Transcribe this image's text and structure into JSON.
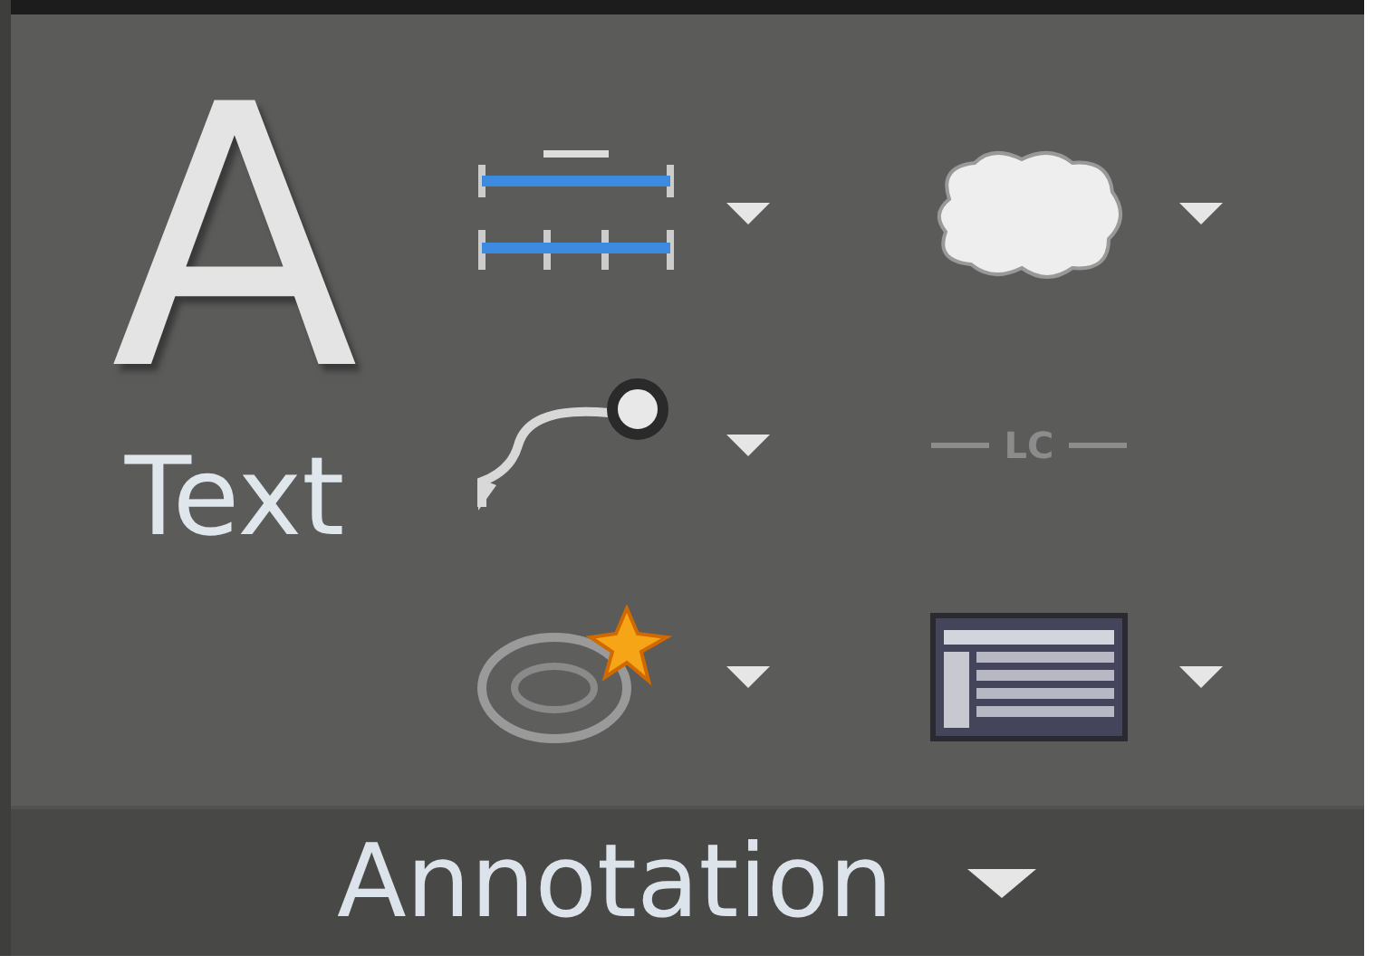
{
  "panel": {
    "title": "Annotation"
  },
  "text_button": {
    "glyph": "A",
    "label": "Text"
  },
  "tools": [
    {
      "kind": "dimension",
      "has_dropdown": true
    },
    {
      "kind": "cloud",
      "has_dropdown": true
    },
    {
      "kind": "leader",
      "has_dropdown": true
    },
    {
      "kind": "centerline",
      "label": "LC",
      "has_dropdown": false
    },
    {
      "kind": "markup",
      "has_dropdown": true
    },
    {
      "kind": "table",
      "has_dropdown": true
    }
  ]
}
